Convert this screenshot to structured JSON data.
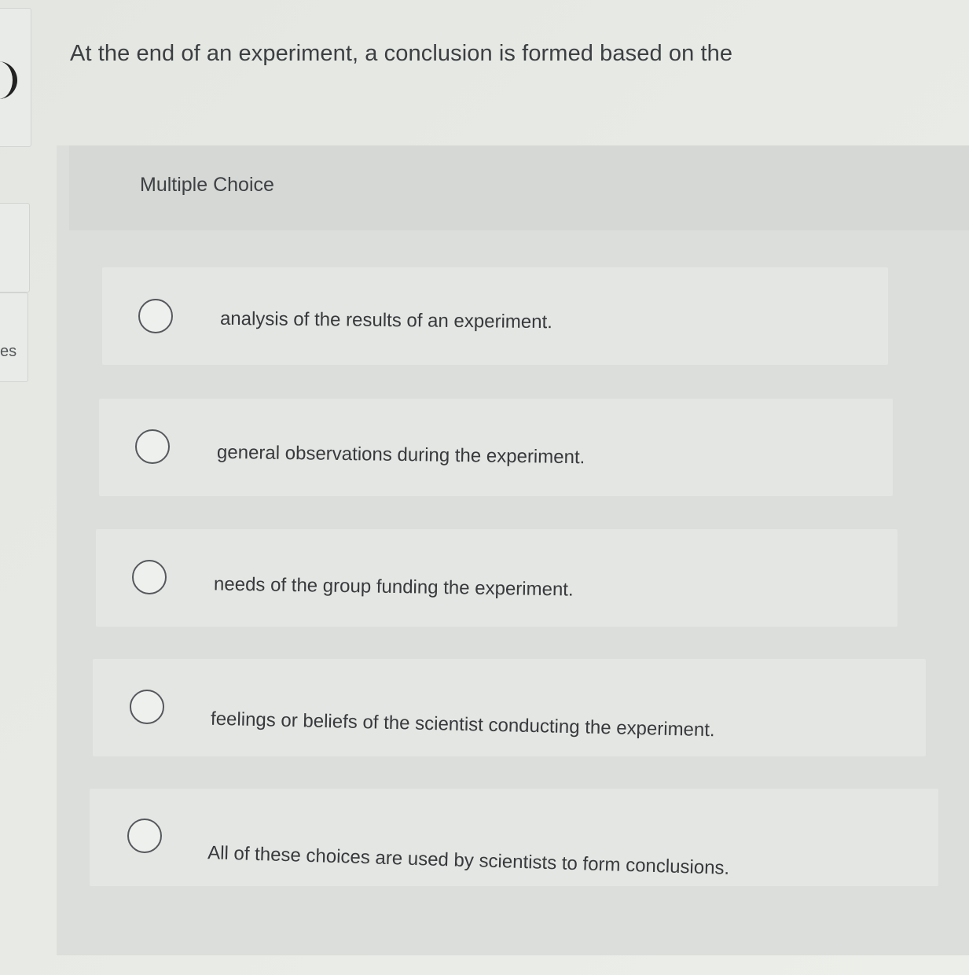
{
  "sidebar": {
    "partial_text": "es"
  },
  "question": {
    "text": "At the end of an experiment, a conclusion is formed based on the"
  },
  "answer_panel": {
    "type_label": "Multiple Choice",
    "options": [
      {
        "label": "analysis of the results of an experiment."
      },
      {
        "label": "general observations during the experiment."
      },
      {
        "label": "needs of the group funding the experiment."
      },
      {
        "label": "feelings or beliefs of the scientist conducting the experiment."
      },
      {
        "label": "All of these choices are used by scientists to form conclusions."
      }
    ]
  }
}
